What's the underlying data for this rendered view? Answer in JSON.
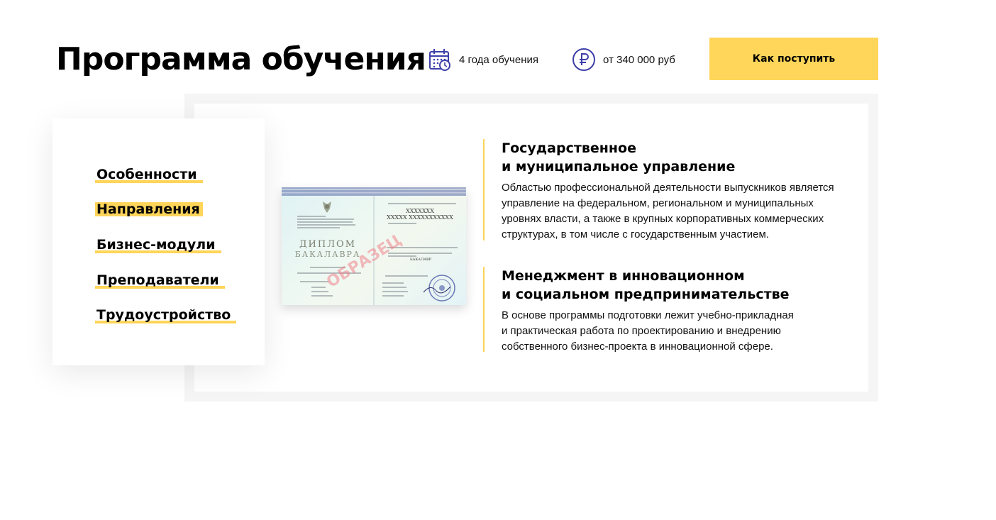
{
  "header": {
    "title": "Программа обучения",
    "duration": {
      "icon": "calendar-clock-icon",
      "text": "4 года обучения"
    },
    "price": {
      "icon": "ruble-icon",
      "text": "от 340 000 руб"
    },
    "apply_label": "Как поступить"
  },
  "sidebar": {
    "items": [
      {
        "label": "Особенности",
        "active": false
      },
      {
        "label": "Направления",
        "active": true
      },
      {
        "label": "Бизнес-модули",
        "active": false
      },
      {
        "label": "Преподаватели",
        "active": false
      },
      {
        "label": "Трудоустройство",
        "active": false
      }
    ]
  },
  "diploma": {
    "heading": "ДИПЛОМ",
    "subheading": "БАКАЛАВРА",
    "stamp": "ОБРАЗЕЦ",
    "placeholder_line1": "XXXXXXX",
    "placeholder_line2": "XXXXX XXXXXXXXXXX",
    "degree": "БАКАЛАВР"
  },
  "sections": [
    {
      "title_line1": "Государственное",
      "title_line2": "и муниципальное управление",
      "body_lines": [
        "Областью профессиональной деятельности выпускников является",
        "управление на федеральном, региональном и муниципальных",
        "уровнях власти, а также в крупных корпоративных коммерческих",
        "структурах, в том числе с государственным участием."
      ]
    },
    {
      "title_line1": "Менеджмент в инновационном",
      "title_line2": "и социальном предпринимательстве",
      "body_lines": [
        "В основе программы подготовки лежит учебно-прикладная",
        "и практическая работа по проектированию и внедрению",
        "собственного бизнес-проекта в инновационной сфере."
      ]
    }
  ],
  "colors": {
    "accent": "#ffd55a",
    "icon": "#3d3fa8",
    "frame": "#f5f5f5"
  }
}
